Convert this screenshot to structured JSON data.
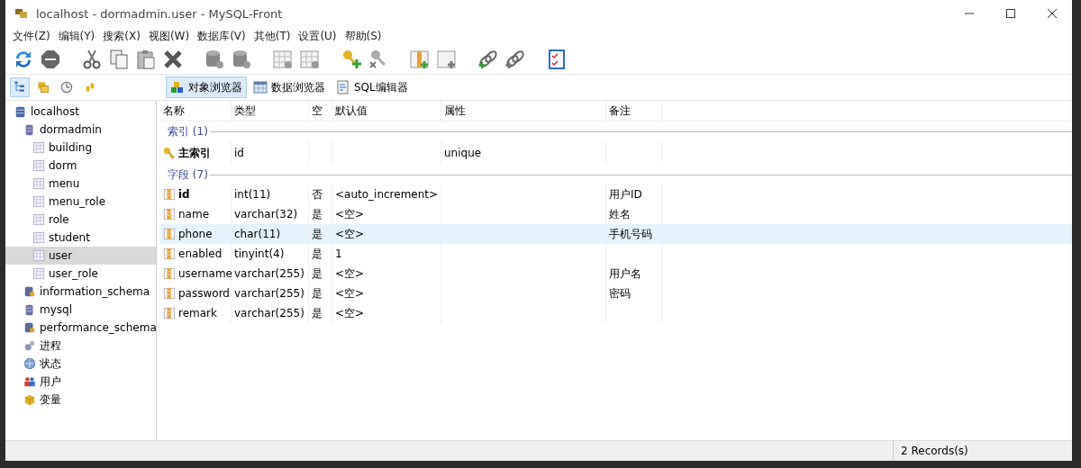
{
  "window": {
    "title": "localhost - dormadmin.user - MySQL-Front"
  },
  "menu": [
    "文件(Z)",
    "编辑(Y)",
    "搜索(X)",
    "视图(W)",
    "数据库(V)",
    "其他(T)",
    "设置(U)",
    "帮助(S)"
  ],
  "view_buttons": [
    {
      "kind": "tree",
      "selected": true
    },
    {
      "kind": "bookmarks",
      "selected": false
    },
    {
      "kind": "history",
      "selected": false
    },
    {
      "kind": "footprints",
      "selected": false
    }
  ],
  "tabs": [
    {
      "kind": "objects",
      "label": "对象浏览器",
      "selected": true
    },
    {
      "kind": "data",
      "label": "数据浏览器",
      "selected": false
    },
    {
      "kind": "sql",
      "label": "SQL编辑器",
      "selected": false
    }
  ],
  "tree": [
    {
      "kind": "server",
      "label": "localhost",
      "selected": false,
      "children": [
        {
          "kind": "database",
          "label": "dormadmin",
          "selected": false,
          "children": [
            {
              "kind": "table",
              "label": "building",
              "selected": false
            },
            {
              "kind": "table",
              "label": "dorm",
              "selected": false
            },
            {
              "kind": "table",
              "label": "menu",
              "selected": false
            },
            {
              "kind": "table",
              "label": "menu_role",
              "selected": false
            },
            {
              "kind": "table",
              "label": "role",
              "selected": false
            },
            {
              "kind": "table",
              "label": "student",
              "selected": false
            },
            {
              "kind": "table",
              "label": "user",
              "selected": true
            },
            {
              "kind": "table",
              "label": "user_role",
              "selected": false
            }
          ]
        },
        {
          "kind": "system",
          "label": "information_schema",
          "selected": false
        },
        {
          "kind": "database",
          "label": "mysql",
          "selected": false
        },
        {
          "kind": "system",
          "label": "performance_schema",
          "selected": false
        },
        {
          "kind": "process",
          "label": "进程",
          "selected": false
        },
        {
          "kind": "status",
          "label": "状态",
          "selected": false
        },
        {
          "kind": "users",
          "label": "用户",
          "selected": false
        },
        {
          "kind": "variables",
          "label": "变量",
          "selected": false
        }
      ]
    }
  ],
  "table": {
    "columns": [
      "名称",
      "类型",
      "空",
      "默认值",
      "属性",
      "备注"
    ],
    "groups": [
      {
        "title": "索引 (1)",
        "rows": [
          {
            "kind": "index",
            "selected": false,
            "cells": [
              "主索引",
              "id",
              "",
              "",
              "unique",
              ""
            ]
          }
        ]
      },
      {
        "title": "字段 (7)",
        "rows": [
          {
            "kind": "field",
            "primary_key": true,
            "selected": false,
            "cells": [
              "id",
              "int(11)",
              "否",
              "<auto_increment>",
              "",
              "用户ID"
            ]
          },
          {
            "kind": "field",
            "primary_key": false,
            "selected": false,
            "cells": [
              "name",
              "varchar(32)",
              "是",
              "<空>",
              "",
              "姓名"
            ]
          },
          {
            "kind": "field",
            "primary_key": false,
            "selected": true,
            "cells": [
              "phone",
              "char(11)",
              "是",
              "<空>",
              "",
              "手机号码"
            ]
          },
          {
            "kind": "field",
            "primary_key": false,
            "selected": false,
            "cells": [
              "enabled",
              "tinyint(4)",
              "是",
              "1",
              "",
              ""
            ]
          },
          {
            "kind": "field",
            "primary_key": false,
            "selected": false,
            "cells": [
              "username",
              "varchar(255)",
              "是",
              "<空>",
              "",
              "用户名"
            ]
          },
          {
            "kind": "field",
            "primary_key": false,
            "selected": false,
            "cells": [
              "password",
              "varchar(255)",
              "是",
              "<空>",
              "",
              "密码"
            ]
          },
          {
            "kind": "field",
            "primary_key": false,
            "selected": false,
            "cells": [
              "remark",
              "varchar(255)",
              "是",
              "<空>",
              "",
              ""
            ]
          }
        ]
      }
    ]
  },
  "status_bar": {
    "records": "2 Records(s)"
  }
}
